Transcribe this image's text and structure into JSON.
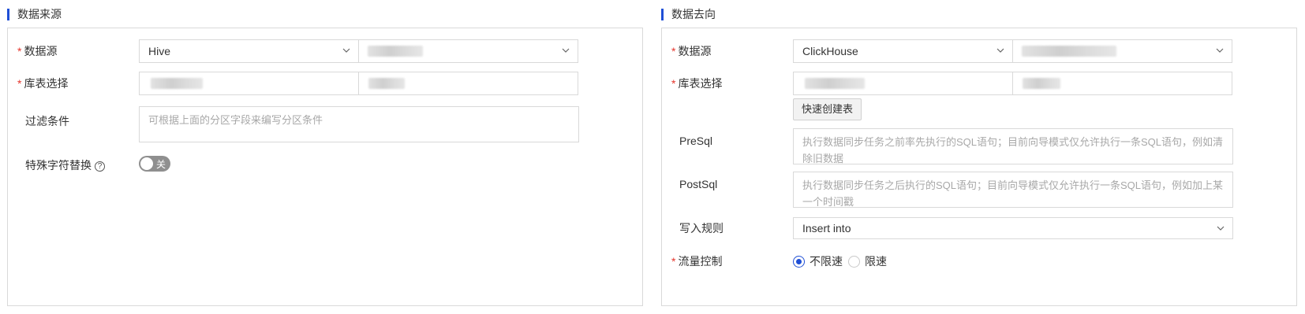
{
  "source": {
    "title": "数据来源",
    "datasource": {
      "label": "数据源",
      "type_value": "Hive"
    },
    "table_select": {
      "label": "库表选择"
    },
    "filter": {
      "label": "过滤条件",
      "placeholder": "可根据上面的分区字段来编写分区条件"
    },
    "special_char": {
      "label": "特殊字符替换",
      "help": "?",
      "toggle_text": "关"
    }
  },
  "target": {
    "title": "数据去向",
    "datasource": {
      "label": "数据源",
      "type_value": "ClickHouse"
    },
    "table_select": {
      "label": "库表选择"
    },
    "quick_create_button": "快速创建表",
    "presql": {
      "label": "PreSql",
      "placeholder": "执行数据同步任务之前率先执行的SQL语句；目前向导模式仅允许执行一条SQL语句，例如清除旧数据"
    },
    "postsql": {
      "label": "PostSql",
      "placeholder": "执行数据同步任务之后执行的SQL语句；目前向导模式仅允许执行一条SQL语句，例如加上某一个时间戳"
    },
    "write_rule": {
      "label": "写入规则",
      "value": "Insert into"
    },
    "flow_control": {
      "label": "流量控制",
      "options": [
        "不限速",
        "限速"
      ],
      "selected": "不限速"
    }
  },
  "colors": {
    "accent": "#1f4fd6",
    "required": "#e5352c",
    "toggle_off": "#8f8f8f"
  }
}
